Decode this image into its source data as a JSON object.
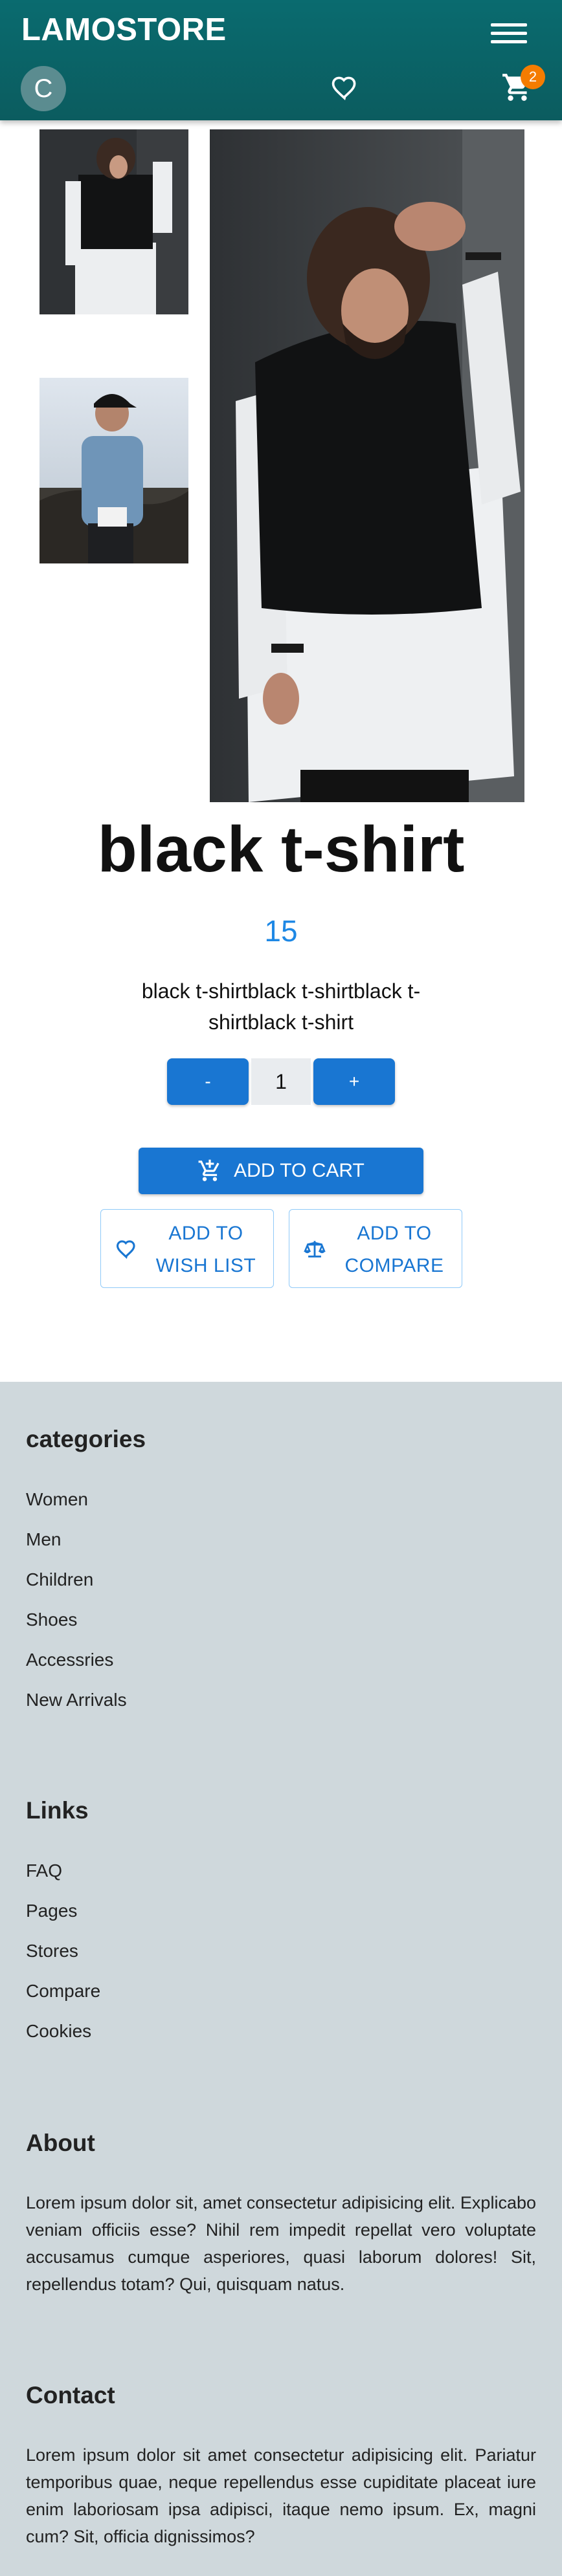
{
  "header": {
    "brand": "LAMOSTORE",
    "avatar_letter": "C",
    "cart_count": "2",
    "accent_color": "#0a6b6f"
  },
  "icons": {
    "menu": "hamburger-menu-icon",
    "wishlist": "heart-icon",
    "cart": "shopping-cart-icon"
  },
  "product": {
    "title": "black t-shirt",
    "price": "15",
    "description": "black t-shirtblack t-shirtblack t-shirtblack t-shirt",
    "quantity": "1",
    "minus_label": "-",
    "plus_label": "+",
    "add_to_cart_label": "ADD TO CART",
    "wish_line1": "ADD TO",
    "wish_line2": "WISH LIST",
    "compare_line1": "ADD TO",
    "compare_line2": "COMPARE"
  },
  "footer": {
    "categories": {
      "title": "categories",
      "items": [
        "Women",
        "Men",
        "Children",
        "Shoes",
        "Accessries",
        "New Arrivals"
      ]
    },
    "links": {
      "title": "Links",
      "items": [
        "FAQ",
        "Pages",
        "Stores",
        "Compare",
        "Cookies"
      ]
    },
    "about": {
      "title": "About",
      "text": "Lorem ipsum dolor sit, amet consectetur adipisicing elit. Explicabo veniam officiis esse? Nihil rem impedit repellat vero voluptate accusamus cumque asperiores, quasi laborum dolores! Sit, repellendus totam? Qui, quisquam natus."
    },
    "contact": {
      "title": "Contact",
      "text": "Lorem ipsum dolor sit amet consectetur adipisicing elit. Pariatur temporibus quae, neque repellendus esse cupiditate placeat iure enim laboriosam ipsa adipisci, itaque nemo ipsum. Ex, magni cum? Sit, officia dignissimos?"
    }
  }
}
